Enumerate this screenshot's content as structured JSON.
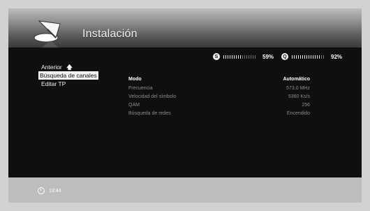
{
  "header": {
    "title": "Instalación"
  },
  "signal": [
    {
      "icon_letter": "S",
      "icon": "signal-strength-icon",
      "level": 0.59,
      "label": "59%"
    },
    {
      "icon_letter": "Q",
      "icon": "signal-quality-icon",
      "level": 0.92,
      "label": "92%"
    }
  ],
  "menu": {
    "items": [
      {
        "label": "Anterior",
        "icon": "arrow-up-icon"
      },
      {
        "label": "Búsqueda de canales",
        "selected": true
      },
      {
        "label": "Editar TP"
      }
    ]
  },
  "details": {
    "header": {
      "key": "Modo",
      "value": "Automático"
    },
    "rows": [
      {
        "key": "Frecuencia",
        "value": "573.0 MHz"
      },
      {
        "key": "Velocidad del símbolo",
        "value": "5360 Ks/s"
      },
      {
        "key": "QAM",
        "value": "256"
      },
      {
        "key": "Búsqueda de redes",
        "value": "Encendido"
      }
    ]
  },
  "footer": {
    "time": "13:44",
    "icon": "clock-icon"
  }
}
